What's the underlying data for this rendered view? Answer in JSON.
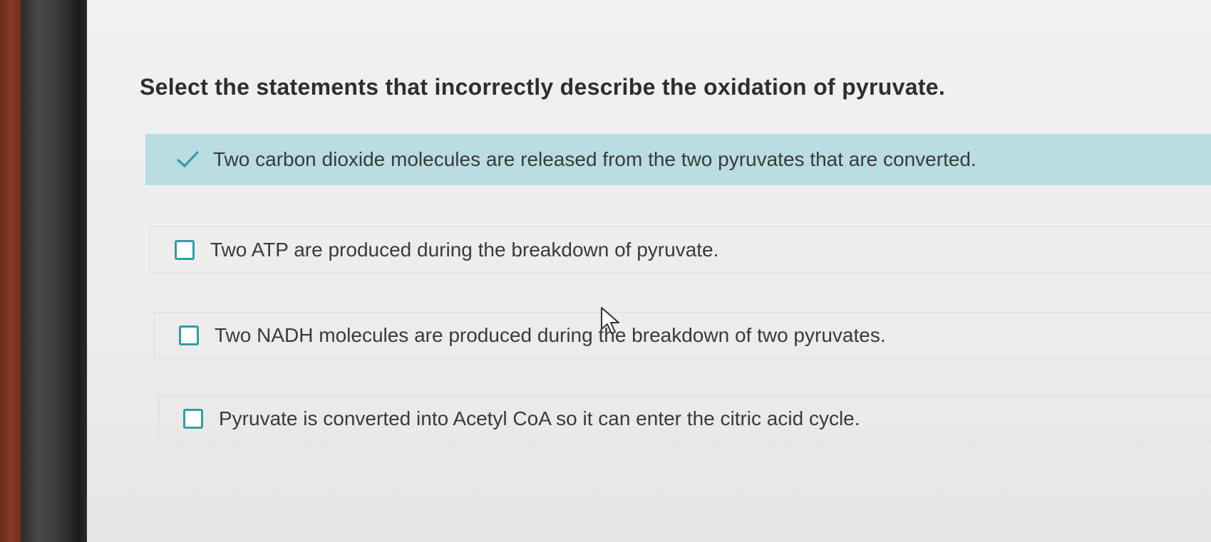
{
  "question": {
    "text": "Select the statements that incorrectly describe the oxidation of pyruvate."
  },
  "options": [
    {
      "text": "Two carbon dioxide molecules are released from the two pyruvates that are converted.",
      "checked": true
    },
    {
      "text": "Two ATP are produced during the breakdown of pyruvate.",
      "checked": false
    },
    {
      "text": "Two NADH molecules are produced during the breakdown of two pyruvates.",
      "checked": false
    },
    {
      "text": "Pyruvate is converted into Acetyl CoA so it can enter the citric acid cycle.",
      "checked": false
    }
  ],
  "icons": {
    "selected_mark": "check-icon",
    "unselected_mark": "checkbox",
    "pointer": "cursor-arrow-icon"
  },
  "colors": {
    "selected_background": "#b9dde0",
    "accent": "#2f9ea6",
    "text": "#3a3a3a"
  }
}
